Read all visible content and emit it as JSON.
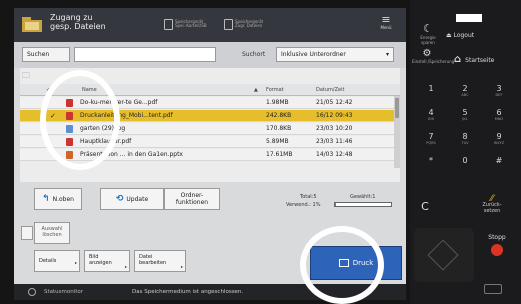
{
  "header": {
    "title_line1": "Zugang zu",
    "title_line2": "gesp. Dateien",
    "storage1_line1": "Speichergerät",
    "storage1_line2": "Spei.-Karte/USB",
    "storage2_line1": "Speichergerät",
    "storage2_line2": "Zugr. Dateien",
    "menu_label": "Menü"
  },
  "search": {
    "button_label": "Suchen",
    "field_value": "",
    "scope_label": "Suchort",
    "scope_value": "Inklusive Unterordner"
  },
  "table": {
    "columns": {
      "name": "Name",
      "format": "Format",
      "date": "Datum/Zeit"
    },
    "rows": [
      {
        "name": "Do-ku-men-ter-te Ge...pdf",
        "size": "1.98MB",
        "date": "21/05 12:42",
        "type": "pdf",
        "selected": false
      },
      {
        "name": "Druckanleitung_Mobi...tent.pdf",
        "size": "242.8KB",
        "date": "16/12 09:43",
        "type": "pdf",
        "selected": true
      },
      {
        "name": "garten (29).jpg",
        "size": "170.8KB",
        "date": "23/03 10:20",
        "type": "jpg",
        "selected": false
      },
      {
        "name": "Hauptklausur.pdf",
        "size": "5.89MB",
        "date": "23/03 11:46",
        "type": "pdf",
        "selected": false
      },
      {
        "name": "Präsentation ... in den Ga1en.pptx",
        "size": "17.61MB",
        "date": "14/03 12:48",
        "type": "pptx",
        "selected": false
      }
    ]
  },
  "nav": {
    "up_label": "N.oben",
    "update_label": "Update",
    "folder_functions_line1": "Ordner-",
    "folder_functions_line2": "funktionen",
    "total_label": "Total:5",
    "selected_label": "Gewählt:1",
    "usage_label": "Verwend.:",
    "usage_value": "1%",
    "usage_fraction": 0.01
  },
  "select": {
    "line1": "Auswahl",
    "line2": "löschen"
  },
  "bottom": {
    "details_label": "Details",
    "image_line1": "Bild",
    "image_line2": "anzeigen",
    "file_line1": "Datei",
    "file_line2": "bearbeiten",
    "print_label": "Druck"
  },
  "statusbar": {
    "monitor_label": "Statusmonitor",
    "message": "Das Speichermedium ist angeschlossen."
  },
  "panel": {
    "sleep_label": "Energie sparen",
    "logout_label": "Logout",
    "settings_label": "Einstell./Speicherung",
    "home_label": "Startseite",
    "keys": [
      {
        "main": "1",
        "sub": ""
      },
      {
        "main": "2",
        "sub": "ABC"
      },
      {
        "main": "3",
        "sub": "DEF"
      },
      {
        "main": "4",
        "sub": "GHI"
      },
      {
        "main": "5",
        "sub": "JKL"
      },
      {
        "main": "6",
        "sub": "MNO"
      },
      {
        "main": "7",
        "sub": "PQRS"
      },
      {
        "main": "8",
        "sub": "TUV"
      },
      {
        "main": "9",
        "sub": "WXYZ"
      },
      {
        "main": "*",
        "sub": ""
      },
      {
        "main": "0",
        "sub": ""
      },
      {
        "main": "#",
        "sub": ""
      }
    ],
    "clear_label": "C",
    "back_line1": "Zurück-",
    "back_line2": "setzen",
    "stop_label": "Stopp"
  }
}
